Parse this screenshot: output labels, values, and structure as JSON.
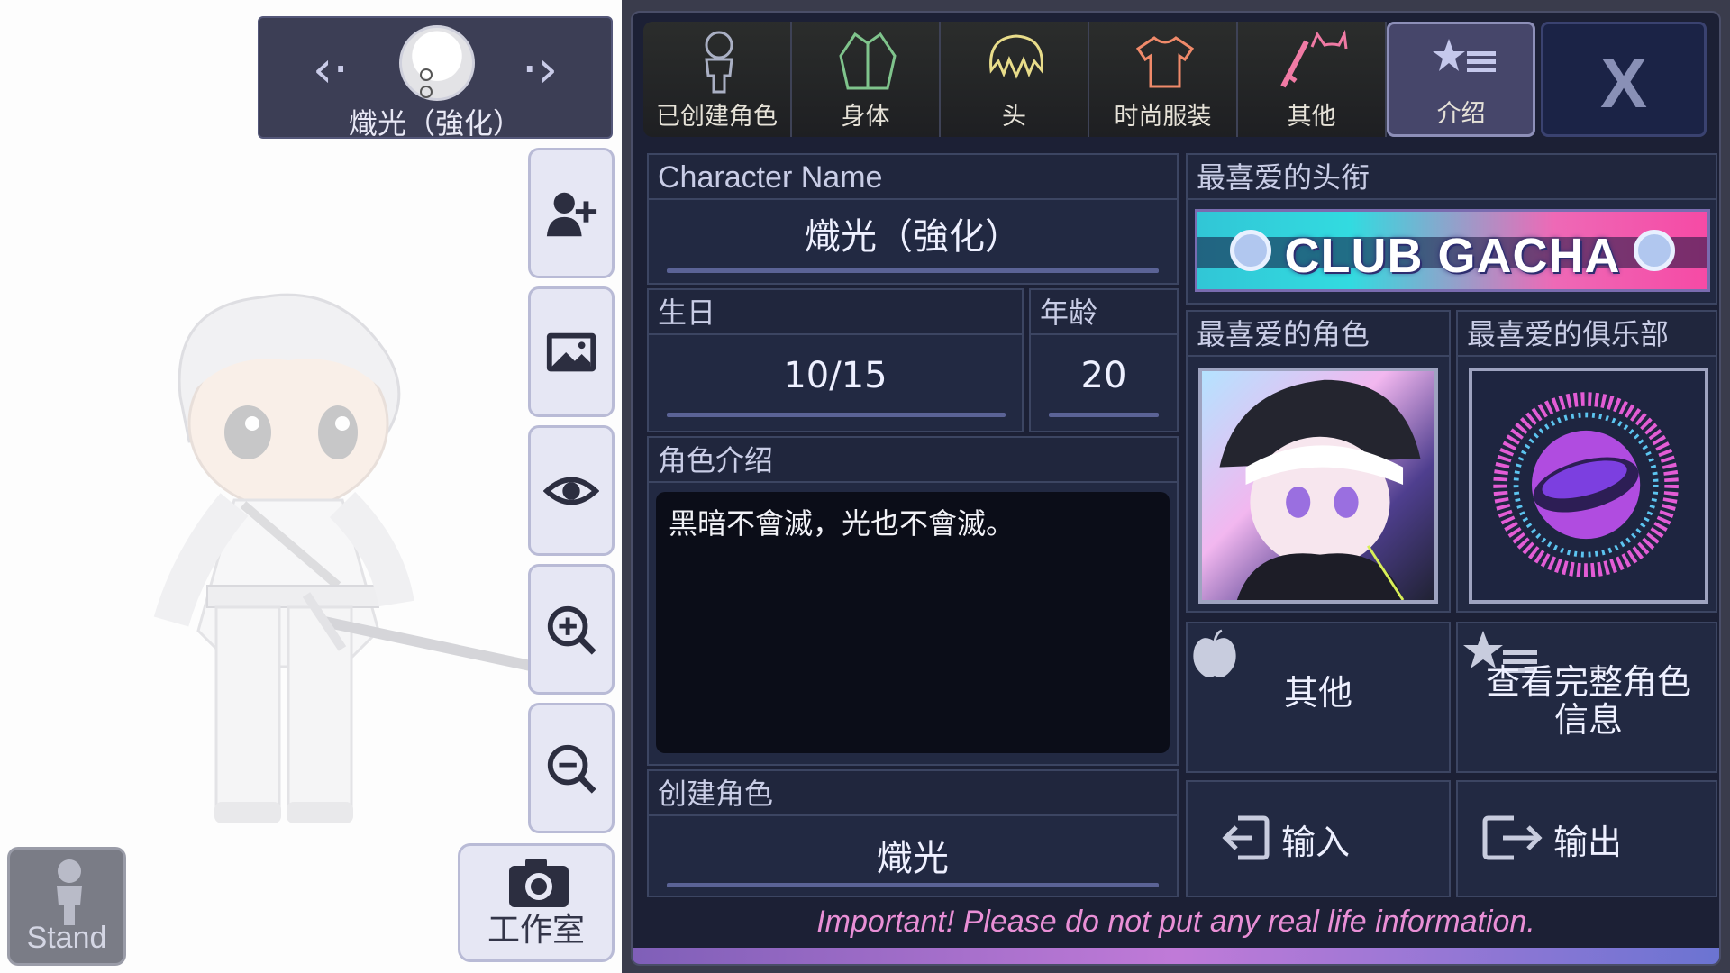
{
  "selector": {
    "name": "熾光（強化）"
  },
  "side_tools": [
    {
      "icon": "add-user-icon"
    },
    {
      "icon": "background-image-icon"
    },
    {
      "icon": "eye-icon"
    },
    {
      "icon": "zoom-in-icon"
    },
    {
      "icon": "zoom-out-icon"
    }
  ],
  "stand": {
    "label": "Stand"
  },
  "studio": {
    "label": "工作室"
  },
  "tabs": [
    {
      "label": "已创建角色",
      "icon": "character-silhouette-icon"
    },
    {
      "label": "身体",
      "icon": "jacket-icon"
    },
    {
      "label": "头",
      "icon": "hair-icon"
    },
    {
      "label": "时尚服装",
      "icon": "tshirt-icon"
    },
    {
      "label": "其他",
      "icon": "sword-cat-icon"
    },
    {
      "label": "介绍",
      "icon": "star-list-icon",
      "active": true
    }
  ],
  "close": {
    "label": "X"
  },
  "profile": {
    "name_header": "Character Name",
    "name": "熾光（強化）",
    "birthday_header": "生日",
    "birthday": "10/15",
    "age_header": "年龄",
    "age": "20",
    "bio_header": "角色介绍",
    "bio": "黑暗不會滅，光也不會滅。",
    "creator_header": "创建角色",
    "creator": "熾光",
    "title_header": "最喜爱的头衔",
    "title": "CLUB GACHA",
    "fav_char_header": "最喜爱的角色",
    "fav_club_header": "最喜爱的俱乐部",
    "other_label": "其他",
    "full_info_label": "查看完整角色信息",
    "import_label": "输入",
    "export_label": "输出"
  },
  "warning": "Important! Please do not put any real life information.",
  "colors": {
    "panel_bg": "#1c2035",
    "accent": "#5b6396",
    "warning": "#e98fd6"
  }
}
